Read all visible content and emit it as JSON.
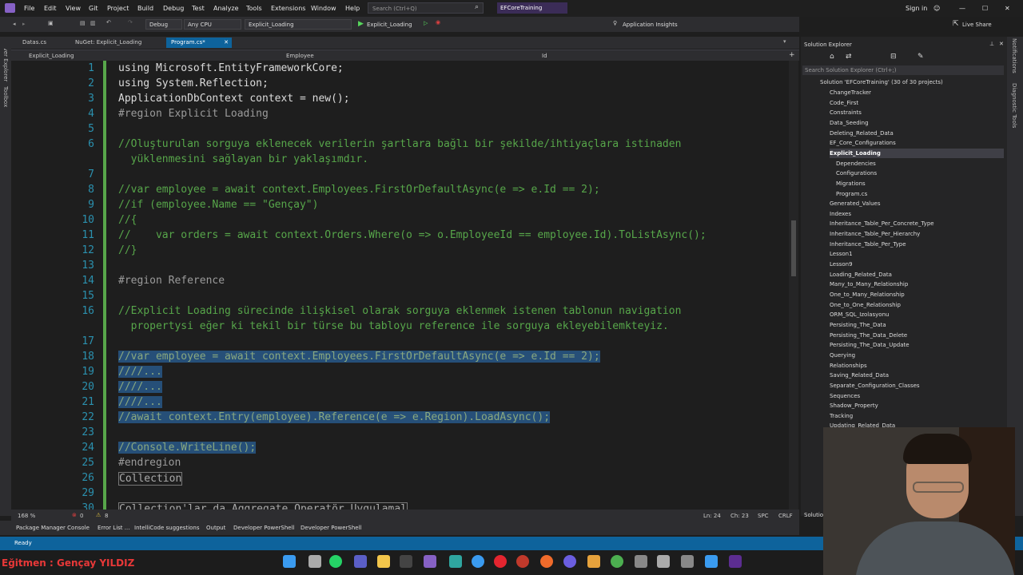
{
  "menu": [
    "File",
    "Edit",
    "View",
    "Git",
    "Project",
    "Build",
    "Debug",
    "Test",
    "Analyze",
    "Tools",
    "Extensions",
    "Window",
    "Help"
  ],
  "search": {
    "placeholder": "Search (Ctrl+Q)"
  },
  "project_title": "EFCoreTraining",
  "sign_in": "Sign in",
  "toolbar": {
    "config": "Debug",
    "platform": "Any CPU",
    "startup": "Explicit_Loading",
    "run": "Explicit_Loading",
    "app_insights": "Application Insights",
    "live_share": "Live Share"
  },
  "tabs": [
    {
      "label": "Datas.cs"
    },
    {
      "label": "NuGet: Explicit_Loading"
    },
    {
      "label": "Program.cs*"
    }
  ],
  "navbar": {
    "project": "Explicit_Loading",
    "type": "Employee",
    "member": "Id"
  },
  "left_strip": [
    "Server Explorer",
    "Toolbox"
  ],
  "right_strip": [
    "Notifications",
    "Diagnostic Tools"
  ],
  "code_lines": [
    {
      "n": "1",
      "t": "using Microsoft.EntityFrameworkCore;"
    },
    {
      "n": "2",
      "t": "using System.Reflection;"
    },
    {
      "n": "3",
      "t": "ApplicationDbContext context = new();"
    },
    {
      "n": "4",
      "t": "#region Explicit Loading"
    },
    {
      "n": "5",
      "t": ""
    },
    {
      "n": "6",
      "t": "//Oluşturulan sorguya eklenecek verilerin şartlara bağlı bir şekilde/ihtiyaçlara istinaden"
    },
    {
      "n": "",
      "t": "  yüklenmesini sağlayan bir yaklaşımdır."
    },
    {
      "n": "7",
      "t": ""
    },
    {
      "n": "8",
      "t": "//var employee = await context.Employees.FirstOrDefaultAsync(e => e.Id == 2);"
    },
    {
      "n": "9",
      "t": "//if (employee.Name == \"Gençay\")"
    },
    {
      "n": "10",
      "t": "//{"
    },
    {
      "n": "11",
      "t": "//    var orders = await context.Orders.Where(o => o.EmployeeId == employee.Id).ToListAsync();"
    },
    {
      "n": "12",
      "t": "//}"
    },
    {
      "n": "13",
      "t": ""
    },
    {
      "n": "14",
      "t": "#region Reference"
    },
    {
      "n": "15",
      "t": ""
    },
    {
      "n": "16",
      "t": "//Explicit Loading sürecinde ilişkisel olarak sorguya eklenmek istenen tablonun navigation"
    },
    {
      "n": "",
      "t": "  propertysi eğer ki tekil bir türse bu tabloyu reference ile sorguya ekleyebilemkteyiz."
    },
    {
      "n": "17",
      "t": ""
    },
    {
      "n": "18",
      "t": "//var employee = await context.Employees.FirstOrDefaultAsync(e => e.Id == 2);"
    },
    {
      "n": "19",
      "t": "////..."
    },
    {
      "n": "20",
      "t": "////..."
    },
    {
      "n": "21",
      "t": "////..."
    },
    {
      "n": "22",
      "t": "//await context.Entry(employee).Reference(e => e.Region).LoadAsync();"
    },
    {
      "n": "23",
      "t": ""
    },
    {
      "n": "24",
      "t": "//Console.WriteLine();"
    },
    {
      "n": "25",
      "t": "#endregion"
    },
    {
      "n": "26",
      "t": "Collection"
    },
    {
      "n": "29",
      "t": ""
    },
    {
      "n": "30",
      "t": "Collection'lar da Aggregate Operatör Uygulamal"
    }
  ],
  "solution_explorer": {
    "title": "Solution Explorer",
    "search_placeholder": "Search Solution Explorer (Ctrl+;)",
    "root": "Solution 'EFCoreTraining' (30 of 30 projects)",
    "items": [
      "ChangeTracker",
      "Code_First",
      "Constraints",
      "Data_Seeding",
      "Deleting_Related_Data",
      "EF_Core_Configurations",
      "Explicit_Loading",
      "Dependencies",
      "Configurations",
      "Migrations",
      "Program.cs",
      "Generated_Values",
      "Indexes",
      "Inheritance_Table_Per_Concrete_Type",
      "Inheritance_Table_Per_Hierarchy",
      "Inheritance_Table_Per_Type",
      "Lesson1",
      "Lesson9",
      "Loading_Related_Data",
      "Many_to_Many_Relationship",
      "One_to_Many_Relationship",
      "One_to_One_Relationship",
      "ORM_SQL_Izolasyonu",
      "Persisting_The_Data",
      "Persisting_The_Data_Delete",
      "Persisting_The_Data_Update",
      "Querying",
      "Relationships",
      "Saving_Related_Data",
      "Separate_Configuration_Classes",
      "Sequences",
      "Shadow_Property",
      "Tracking",
      "Updating_Related_Data"
    ],
    "solution_tab": "Solution"
  },
  "editor_status": {
    "zoom": "168 %",
    "errors": "0",
    "warnings": "8",
    "line": "Ln: 24",
    "col": "Ch: 23",
    "spc": "SPC",
    "crlf": "CRLF"
  },
  "bottom_tabs": [
    "Package Manager Console",
    "Error List ...",
    "IntelliCode suggestions",
    "Output",
    "Developer PowerShell",
    "Developer PowerShell"
  ],
  "status": "Ready",
  "instructor": "Eğitmen : Gençay YILDIZ",
  "colors": {
    "accent": "#0e639c",
    "comment": "#57a64a",
    "keyword": "#569cd6",
    "type": "#4ec9b0"
  }
}
